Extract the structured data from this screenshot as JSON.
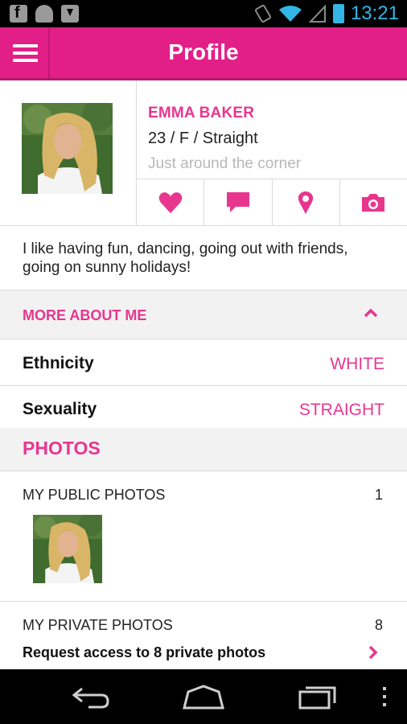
{
  "status_bar": {
    "time": "13:21",
    "left_icons": [
      "facebook-icon",
      "android-icon",
      "download-icon"
    ],
    "right_icons": [
      "vibrate-icon",
      "wifi-icon",
      "signal-icon",
      "battery-icon"
    ],
    "accent": "#33b5e5"
  },
  "app_bar": {
    "title": "Profile",
    "menu_icon": "hamburger-menu-icon",
    "color": "#e21f87"
  },
  "profile": {
    "name": "EMMA BAKER",
    "details": "23 / F / Straight",
    "location": "Just around the corner",
    "bio": "I like having fun, dancing, going out with friends, going on sunny holidays!",
    "actions": [
      "heart-icon",
      "chat-icon",
      "location-pin-icon",
      "camera-icon"
    ]
  },
  "more_about": {
    "title": "MORE ABOUT ME",
    "rows": [
      {
        "label": "Ethnicity",
        "value": "WHITE"
      },
      {
        "label": "Sexuality",
        "value": "STRAIGHT"
      }
    ]
  },
  "photos": {
    "title": "PHOTOS",
    "public": {
      "label": "MY PUBLIC PHOTOS",
      "count": "1"
    },
    "private": {
      "label": "MY PRIVATE PHOTOS",
      "count": "8",
      "request": "Request access to 8 private photos"
    }
  },
  "nav_bar": [
    "back-icon",
    "home-icon",
    "recent-apps-icon",
    "overflow-menu-icon"
  ],
  "colors": {
    "accent": "#e8368f",
    "section_bg": "#f2f2f2",
    "divider": "#dcdcdc"
  }
}
